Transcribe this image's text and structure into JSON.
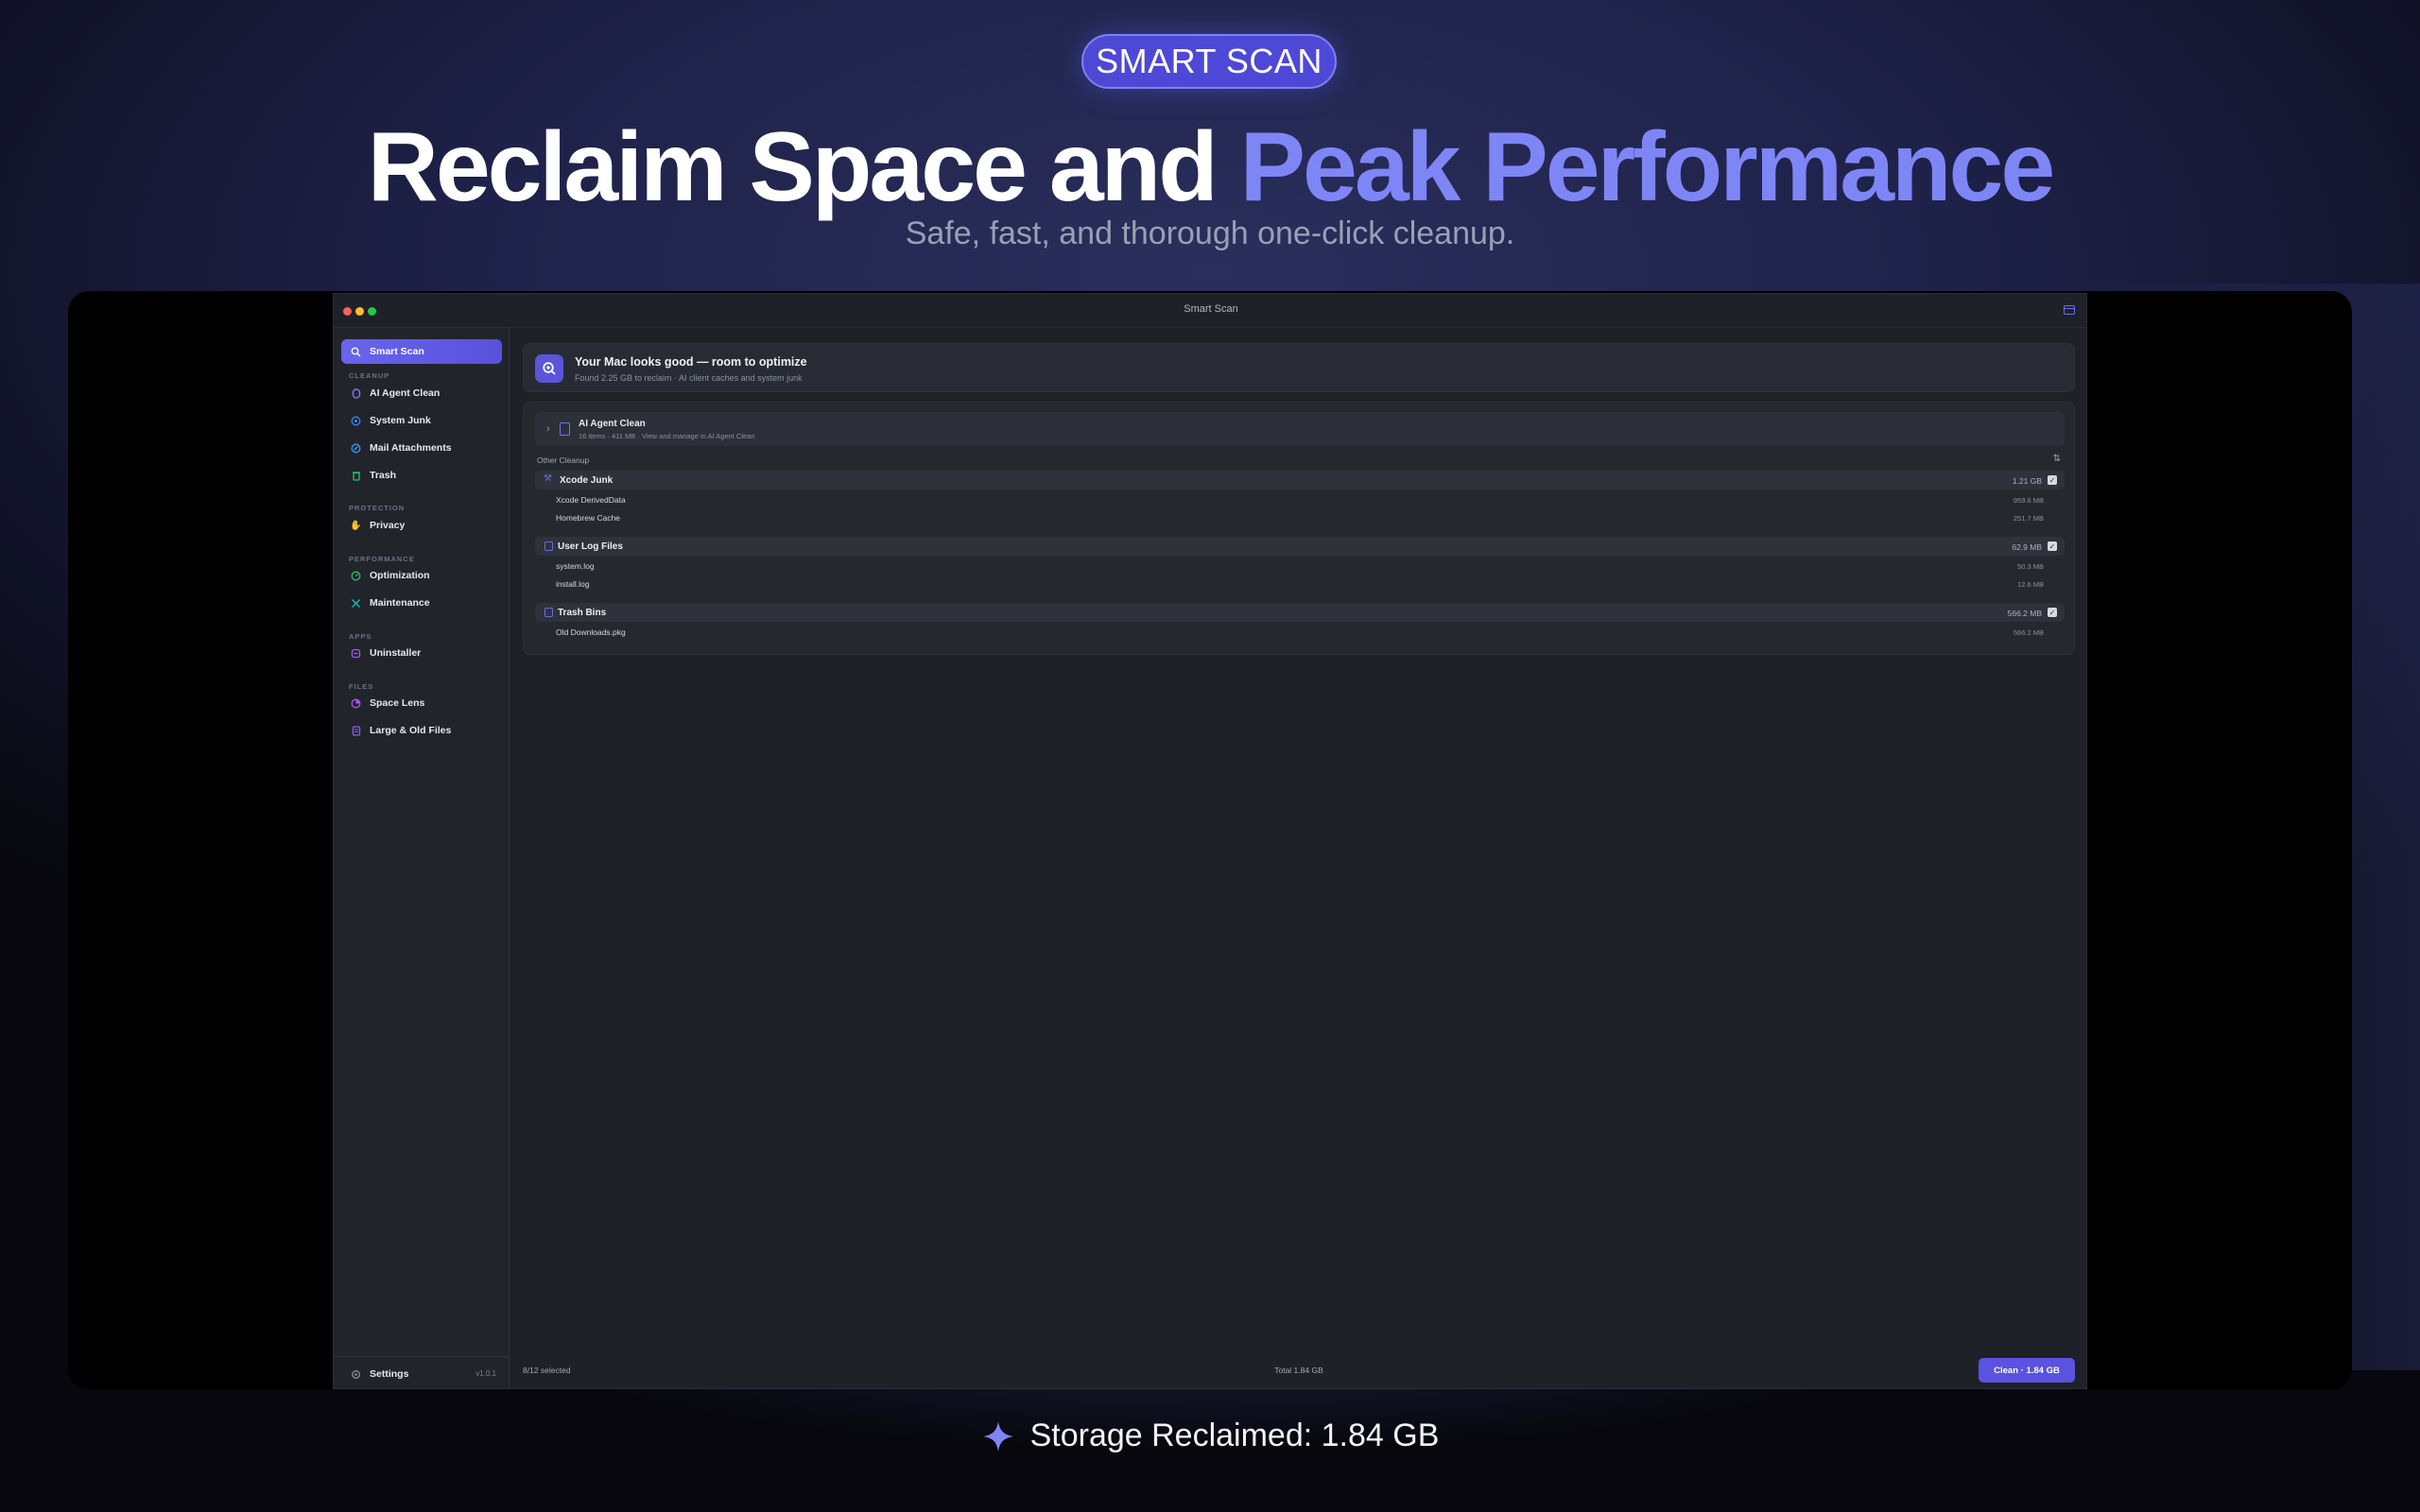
{
  "hero": {
    "badge": "SMART SCAN",
    "headline_main": "Reclaim Space and ",
    "headline_accent": "Peak Performance",
    "subline": "Safe, fast, and thorough one-click cleanup.",
    "caption": "Storage Reclaimed: 1.84 GB"
  },
  "window": {
    "title": "Smart Scan"
  },
  "sidebar": {
    "active_item": "Smart Scan",
    "sections": {
      "cleanup": "CLEANUP",
      "protection": "PROTECTION",
      "performance": "PERFORMANCE",
      "apps": "APPS",
      "files": "FILES"
    },
    "items": {
      "ai_agent_clean": "AI Agent Clean",
      "system_junk": "System Junk",
      "mail_attachments": "Mail Attachments",
      "trash": "Trash",
      "privacy": "Privacy",
      "optimization": "Optimization",
      "maintenance": "Maintenance",
      "uninstaller": "Uninstaller",
      "space_lens": "Space Lens",
      "large_old_files": "Large & Old Files"
    },
    "settings": "Settings",
    "version": "v1.0.1"
  },
  "banner": {
    "title": "Your Mac looks good — room to optimize",
    "subtitle": "Found 2.25 GB to reclaim · AI client caches and system junk"
  },
  "agent": {
    "title": "AI Agent Clean",
    "subtitle": "16 items · 411 MB · View and manage in AI Agent Clean"
  },
  "other_cleanup": {
    "label": "Other Cleanup",
    "categories": [
      {
        "name": "Xcode Junk",
        "size": "1.21 GB",
        "items": [
          {
            "name": "Xcode DerivedData",
            "size": "959.6 MB"
          },
          {
            "name": "Homebrew Cache",
            "size": "251.7 MB"
          }
        ]
      },
      {
        "name": "User Log Files",
        "size": "62.9 MB",
        "items": [
          {
            "name": "system.log",
            "size": "50.3 MB"
          },
          {
            "name": "install.log",
            "size": "12.6 MB"
          }
        ]
      },
      {
        "name": "Trash Bins",
        "size": "566.2 MB",
        "items": [
          {
            "name": "Old Downloads.pkg",
            "size": "566.2 MB"
          }
        ]
      }
    ]
  },
  "footer": {
    "selected": "8/12 selected",
    "total": "Total 1.84 GB",
    "clean_button": "Clean · 1.84 GB"
  },
  "colors": {
    "accent": "#5a55dc",
    "headline_accent": "#7e86f6",
    "window_bg": "#1f2129",
    "sidebar_bg": "#22242c"
  }
}
